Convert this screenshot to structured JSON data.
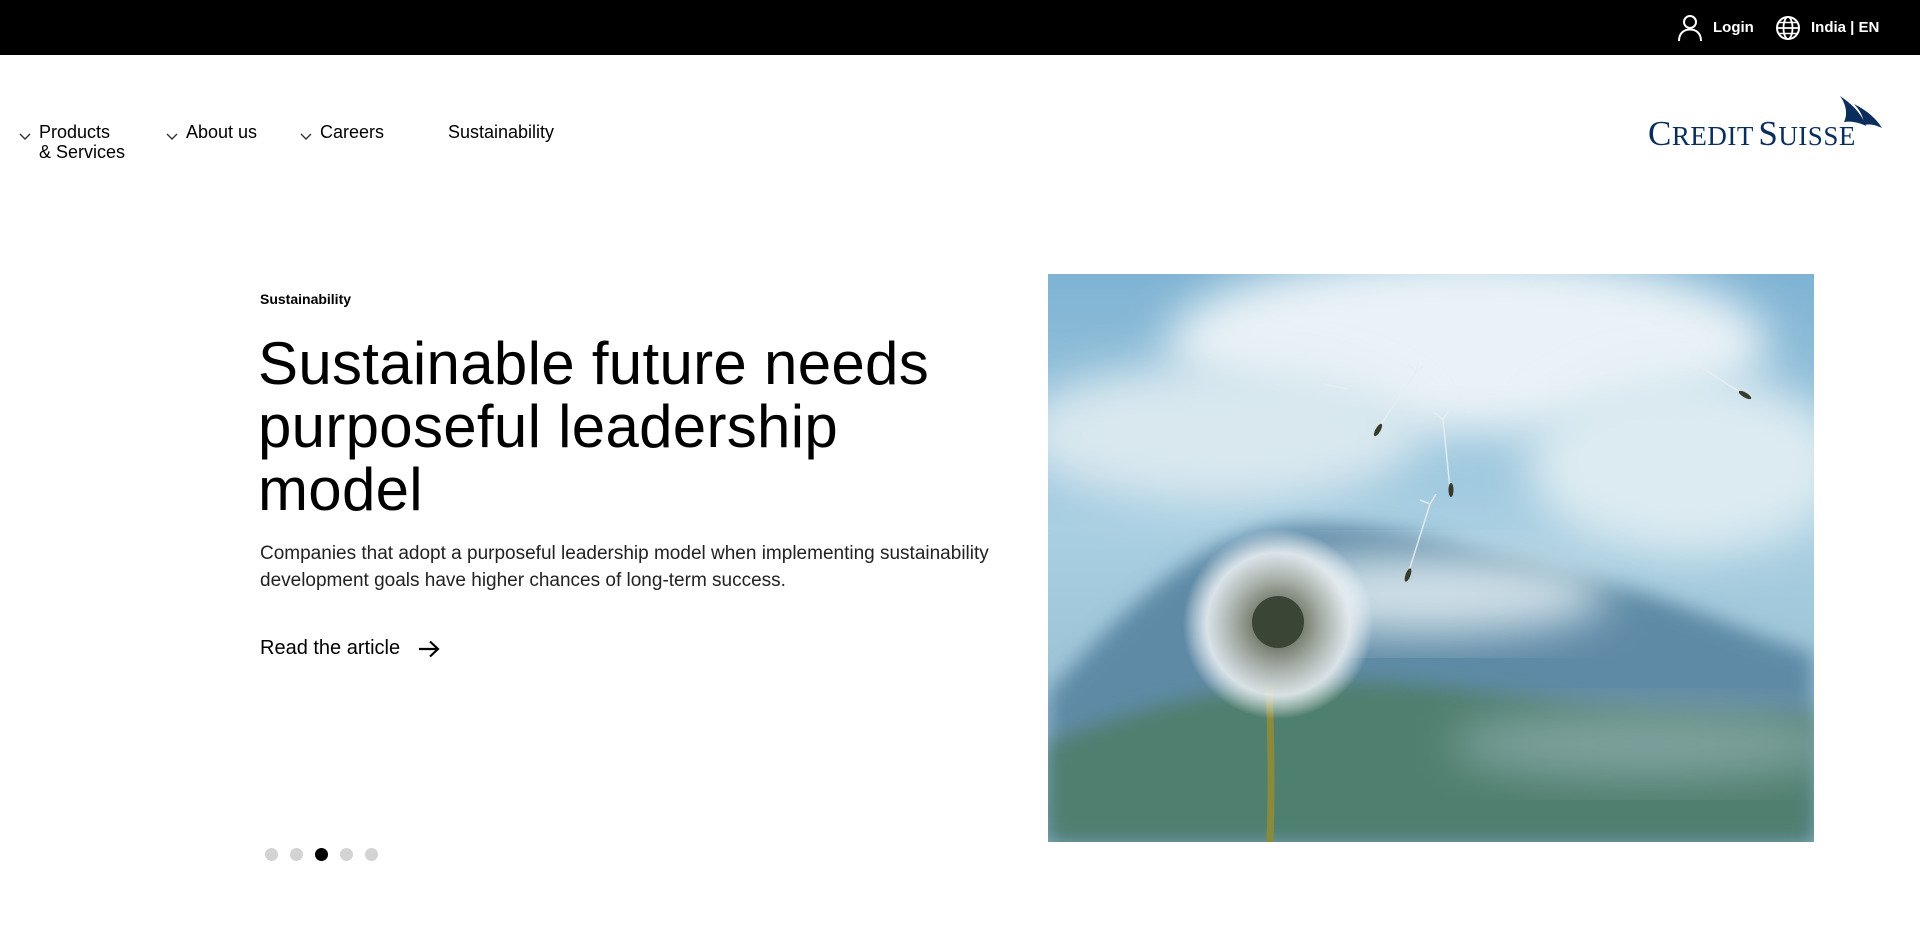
{
  "utility_bar": {
    "login_label": "Login",
    "locale_label": "India | EN",
    "icons": {
      "login": "user-icon",
      "locale": "globe-icon"
    }
  },
  "nav": {
    "items": [
      {
        "line1": "Products",
        "line2": "& Services",
        "has_dropdown": true
      },
      {
        "line1": "About us",
        "has_dropdown": true
      },
      {
        "line1": "Careers",
        "has_dropdown": true
      },
      {
        "line1": "Sustainability",
        "has_dropdown": false
      }
    ],
    "dropdown_icon": "chevron-down-icon"
  },
  "logo": {
    "word1_initial": "C",
    "word1_rest": "REDIT",
    "word2_initial": "S",
    "word2_rest": "UISSE",
    "icon": "sail-logo-icon",
    "color": "#0b2d5c"
  },
  "hero": {
    "eyebrow": "Sustainability",
    "headline": "Sustainable future needs purposeful leadership model",
    "summary": "Companies that adopt a purposeful leadership model when implementing sustainability development goals have higher chances of long-term success.",
    "cta_label": "Read the article",
    "cta_icon": "arrow-right-icon",
    "image_subject": "dandelion-photo"
  },
  "carousel": {
    "total_slides": 5,
    "active_slide": 3
  },
  "colors": {
    "topbar": "#000000",
    "text": "#000000",
    "dot_inactive": "#d3d3d3",
    "dot_active": "#000000"
  }
}
